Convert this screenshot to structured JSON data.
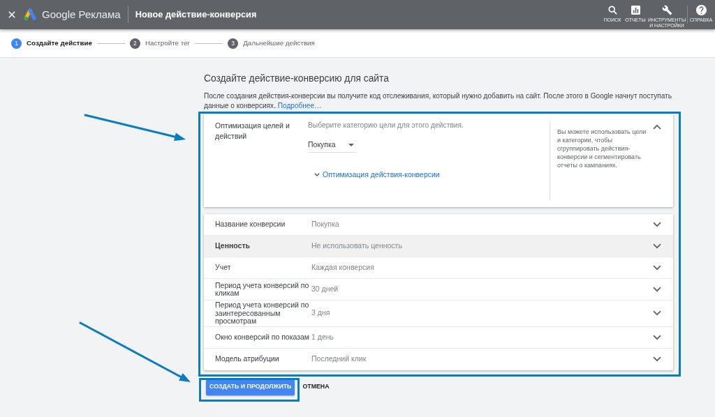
{
  "header": {
    "brand": "Google Реклама",
    "title": "Новое действие-конверсия",
    "actions": [
      {
        "kind": "search",
        "label": "ПОИСК"
      },
      {
        "kind": "reports",
        "label": "ОТЧЕТЫ"
      },
      {
        "kind": "tools",
        "label": "ИНСТРУМЕНТЫ И НАСТРОЙКИ"
      },
      {
        "kind": "help",
        "label": "СПРАВКА"
      }
    ]
  },
  "stepper": [
    {
      "number": "1",
      "label": "Создайте действие",
      "selected": true
    },
    {
      "number": "2",
      "label": "Настройте тег",
      "selected": false
    },
    {
      "number": "3",
      "label": "Дальнейшие действия",
      "selected": false
    }
  ],
  "page": {
    "title": "Создайте действие-конверсию для сайта",
    "description": "После создания действия-конверсии вы получите код отслеживания, который нужно добавить на сайт. После этого в Google начнут поступать данные о конверсиях.",
    "link": "Подробнее…"
  },
  "goal_card": {
    "label": "Оптимизация целей и действий",
    "prompt": "Выберите категорию цели для этого действия.",
    "dropdown": {
      "value": "Покупка"
    },
    "link": "Оптимизация действия-конверсии",
    "help": "Вы можете использовать цели и категории, чтобы сгруппировать действия-конверсии и сегментировать отчеты о кампаниях.",
    "expanded": true
  },
  "settings": [
    {
      "label": "Название конверсии",
      "value": "Покупка",
      "highlighted": false,
      "expanded": false
    },
    {
      "label": "Ценность",
      "value": "Не использовать ценность",
      "highlighted": true,
      "expanded": false
    },
    {
      "label": "Учет",
      "value": "Каждая конверсия",
      "highlighted": false,
      "expanded": false
    },
    {
      "label": "Период учета конверсий по кликам",
      "value": "30 дней",
      "highlighted": false,
      "expanded": false
    },
    {
      "label": "Период учета конверсий по заинтересованным просмотрам",
      "value": "3 дня",
      "highlighted": false,
      "expanded": false
    },
    {
      "label": "Окно конверсий по показам",
      "value": "1 день",
      "highlighted": false,
      "expanded": false
    },
    {
      "label": "Модель атрибуции",
      "value": "Последний клик",
      "highlighted": false,
      "expanded": false
    }
  ],
  "buttons": [
    {
      "kind": "primary",
      "label": "СОЗДАТЬ И ПРОДОЛЖИТЬ"
    },
    {
      "kind": "text",
      "label": "ОТМЕНА"
    }
  ]
}
